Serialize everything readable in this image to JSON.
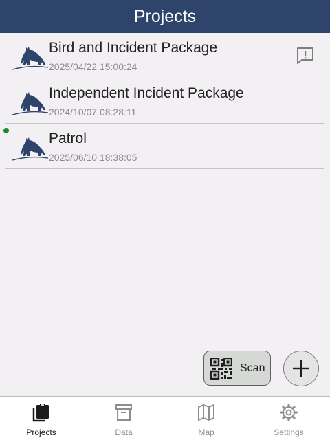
{
  "header": {
    "title": "Projects"
  },
  "projects": [
    {
      "name": "Bird and Incident Package",
      "date": "2025/04/22 15:00:24"
    },
    {
      "name": "Independent Incident Package",
      "date": "2024/10/07 08:28:11"
    },
    {
      "name": "Patrol",
      "date": "2025/06/10 18:38:05"
    }
  ],
  "actions": {
    "scan_label": "Scan"
  },
  "nav": {
    "items": [
      {
        "label": "Projects"
      },
      {
        "label": "Data"
      },
      {
        "label": "Map"
      },
      {
        "label": "Settings"
      }
    ]
  },
  "colors": {
    "header_bg": "#2f446b",
    "logo": "#2f446b",
    "active_dot": "#1e8a2a"
  }
}
